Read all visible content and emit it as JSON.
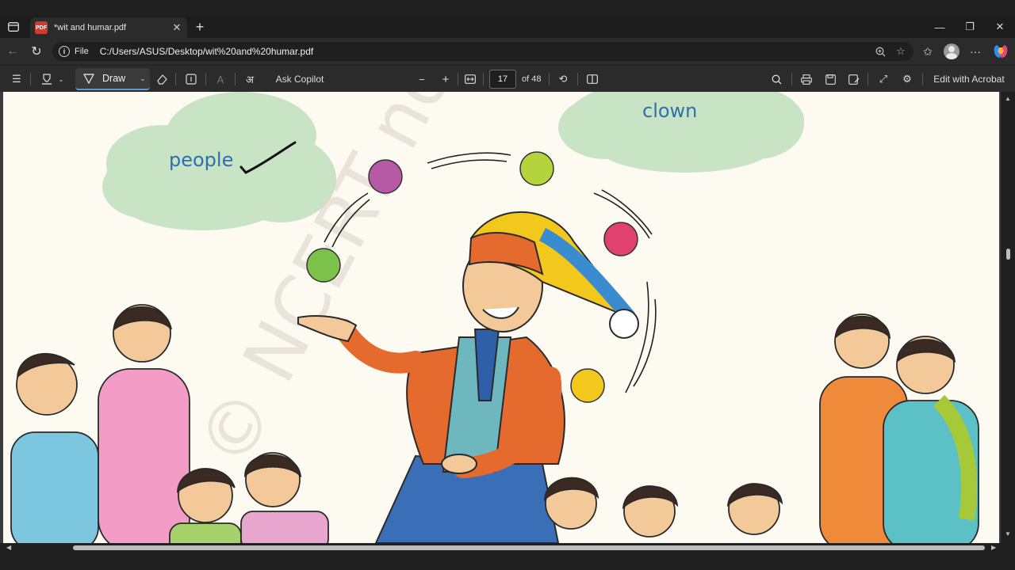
{
  "tab": {
    "title": "*wit and humar.pdf",
    "badge": "PDF"
  },
  "address": {
    "scheme": "File",
    "url": "C:/Users/ASUS/Desktop/wit%20and%20humar.pdf"
  },
  "pdf_toolbar": {
    "draw_label": "Draw",
    "ask_copilot": "Ask Copilot",
    "current_page": "17",
    "page_total": "of 48",
    "edit_acrobat": "Edit with Acrobat"
  },
  "page_content": {
    "cloud_left_word": "people",
    "cloud_right_word": "clown",
    "watermark": "© NCERT not to be republished"
  },
  "colors": {
    "cloud": "#c9e4c5",
    "label_blue": "#2e6fad",
    "ball_green": "#7cc24a",
    "ball_purple": "#b65aa6",
    "ball_lime": "#b5d33a",
    "ball_pink": "#e0416e",
    "ball_yellow": "#f2c81c"
  }
}
